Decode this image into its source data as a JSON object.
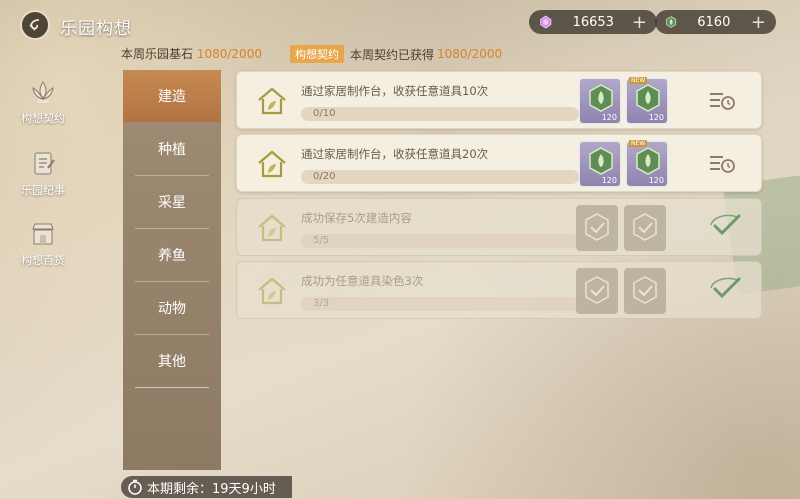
{
  "header": {
    "title": "乐园构想",
    "currencies": [
      {
        "icon": "pink-gem-icon",
        "value": "16653",
        "plus": "+",
        "color": "#d58be6"
      },
      {
        "icon": "green-leaf-token-icon",
        "value": "6160",
        "plus": "+",
        "color": "#7faf6e"
      }
    ]
  },
  "sub_info": {
    "stone_label": "本周乐园基石",
    "stone_value": "1080/2000",
    "pact_tag": "构想契约",
    "pact_label": "本周契约已获得",
    "pact_value": "1080/2000"
  },
  "sidebar": {
    "items": [
      {
        "label": "构想契约",
        "icon": "lotus-emblem-icon"
      },
      {
        "label": "乐园纪事",
        "icon": "journal-icon"
      },
      {
        "label": "构想百货",
        "icon": "shop-icon"
      }
    ]
  },
  "tabs": [
    {
      "label": "建造",
      "active": true
    },
    {
      "label": "种植",
      "active": false
    },
    {
      "label": "采星",
      "active": false
    },
    {
      "label": "养鱼",
      "active": false
    },
    {
      "label": "动物",
      "active": false
    },
    {
      "label": "其他",
      "active": false
    }
  ],
  "tasks": [
    {
      "description": "通过家居制作台，收获任意道具10次",
      "progress_text": "0/10",
      "progress": 0,
      "completed": false,
      "rewards": [
        {
          "icon": "green-crystal-icon",
          "count": "120",
          "tag": ""
        },
        {
          "icon": "green-crystal-icon",
          "count": "120",
          "tag": "NEW"
        }
      ],
      "action_icon": "list-clock-icon"
    },
    {
      "description": "通过家居制作台，收获任意道具20次",
      "progress_text": "0/20",
      "progress": 0,
      "completed": false,
      "rewards": [
        {
          "icon": "green-crystal-icon",
          "count": "120",
          "tag": ""
        },
        {
          "icon": "green-crystal-icon",
          "count": "120",
          "tag": "NEW"
        }
      ],
      "action_icon": "list-clock-icon"
    },
    {
      "description": "成功保存5次建造内容",
      "progress_text": "5/5",
      "progress": 1,
      "completed": true,
      "rewards": [
        {
          "icon": "claimed-check-icon",
          "count": "",
          "tag": ""
        },
        {
          "icon": "claimed-check-icon",
          "count": "",
          "tag": ""
        }
      ],
      "action_icon": "completed-check-icon"
    },
    {
      "description": "成功为任意道具染色3次",
      "progress_text": "3/3",
      "progress": 1,
      "completed": true,
      "rewards": [
        {
          "icon": "claimed-check-icon",
          "count": "",
          "tag": ""
        },
        {
          "icon": "claimed-check-icon",
          "count": "",
          "tag": ""
        }
      ],
      "action_icon": "completed-check-icon"
    }
  ],
  "footer": {
    "timer_label": "本期剩余：19天9小时"
  },
  "colors": {
    "accent_orange": "#d9822b",
    "tab_active": "#c78a52",
    "check_green": "#6f9a67"
  }
}
